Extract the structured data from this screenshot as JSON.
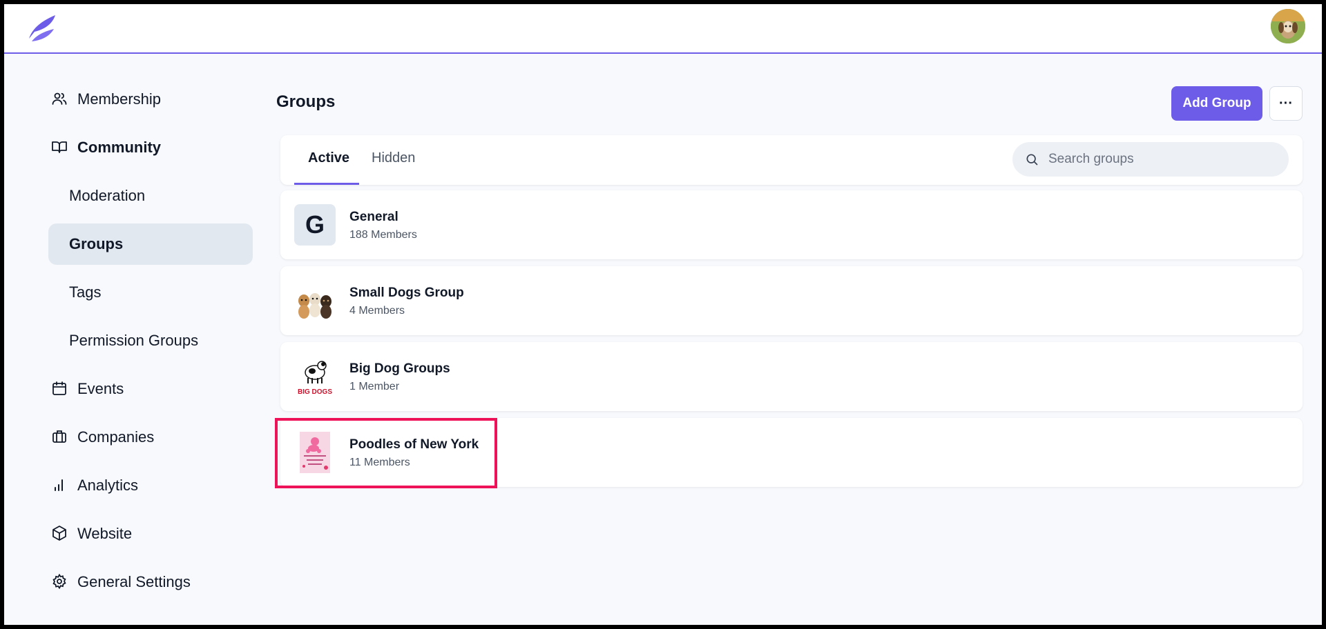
{
  "sidebar": {
    "items": [
      {
        "label": "Membership",
        "icon": "users-icon"
      },
      {
        "label": "Community",
        "icon": "book-icon"
      },
      {
        "label": "Moderation"
      },
      {
        "label": "Groups"
      },
      {
        "label": "Tags"
      },
      {
        "label": "Permission Groups"
      },
      {
        "label": "Events",
        "icon": "calendar-icon"
      },
      {
        "label": "Companies",
        "icon": "briefcase-icon"
      },
      {
        "label": "Analytics",
        "icon": "bar-chart-icon"
      },
      {
        "label": "Website",
        "icon": "cube-icon"
      },
      {
        "label": "General Settings",
        "icon": "gear-icon"
      }
    ]
  },
  "header": {
    "title": "Groups",
    "add_label": "Add Group",
    "more_label": "···"
  },
  "tabs": [
    {
      "label": "Active"
    },
    {
      "label": "Hidden"
    }
  ],
  "search": {
    "placeholder": "Search groups"
  },
  "groups": [
    {
      "name": "General",
      "members": "188 Members",
      "thumb": "G"
    },
    {
      "name": "Small Dogs Group",
      "members": "4 Members"
    },
    {
      "name": "Big Dog Groups",
      "members": "1 Member",
      "thumb_text": "BIG DOGS"
    },
    {
      "name": "Poodles of New York",
      "members": "11 Members"
    }
  ],
  "colors": {
    "accent": "#6c5ce7",
    "highlight": "#ee1358",
    "active_bg": "#e2e8f0"
  }
}
